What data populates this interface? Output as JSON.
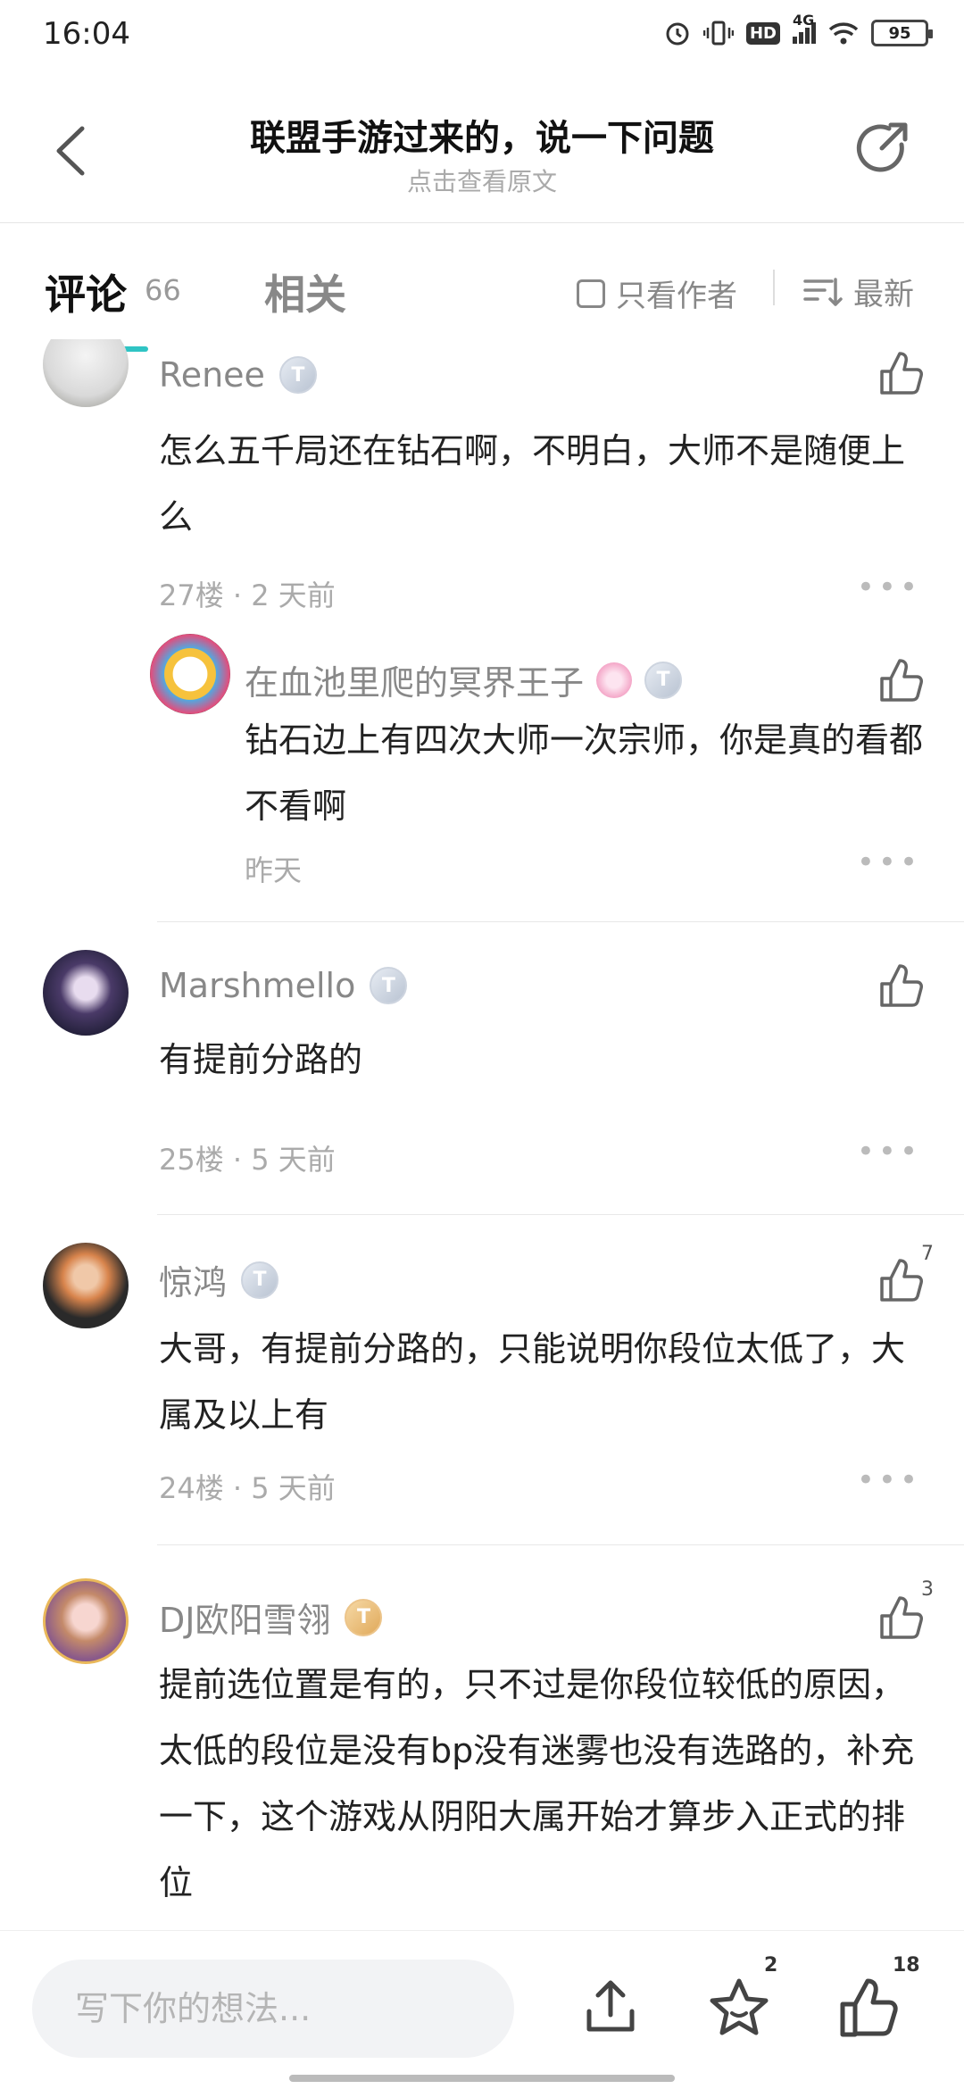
{
  "status_bar": {
    "time": "16:04",
    "network": "4G",
    "hd": "HD",
    "battery": "95"
  },
  "header": {
    "title": "联盟手游过来的，说一下问题",
    "subtitle": "点击查看原文"
  },
  "tabs": {
    "comments_label": "评论",
    "comments_count": "66",
    "related_label": "相关",
    "only_author_label": "只看作者",
    "sort_label": "最新"
  },
  "comments": [
    {
      "username": "Renee",
      "badge": "T",
      "text": "怎么五千局还在钻石啊，不明白，大师不是随便上么",
      "meta": "27楼 · 2 天前",
      "likes": "",
      "reply": {
        "username": "在血池里爬的冥界王子",
        "badge": "T",
        "text": "钻石边上有四次大师一次宗师，你是真的看都不看啊",
        "meta": "昨天"
      }
    },
    {
      "username": "Marshmello",
      "badge": "T",
      "text": "有提前分路的",
      "meta": "25楼 · 5 天前",
      "likes": ""
    },
    {
      "username": "惊鸿",
      "badge": "T",
      "text": "大哥，有提前分路的，只能说明你段位太低了，大属及以上有",
      "meta": "24楼 · 5 天前",
      "likes": "7"
    },
    {
      "username": "DJ欧阳雪翎",
      "badge": "T",
      "text": "提前选位置是有的，只不过是你段位较低的原因，太低的段位是没有bp没有迷雾也没有选路的，补充一下，这个游戏从阴阳大属开始才算步入正式的排位",
      "meta": "",
      "likes": "3"
    }
  ],
  "bottom_bar": {
    "input_placeholder": "写下你的想法...",
    "favorites_count": "2",
    "likes_count": "18"
  },
  "colors": {
    "accent": "#2fc4c4",
    "text_primary": "#222222",
    "text_secondary": "#888888",
    "text_meta": "#aaaaaa"
  }
}
